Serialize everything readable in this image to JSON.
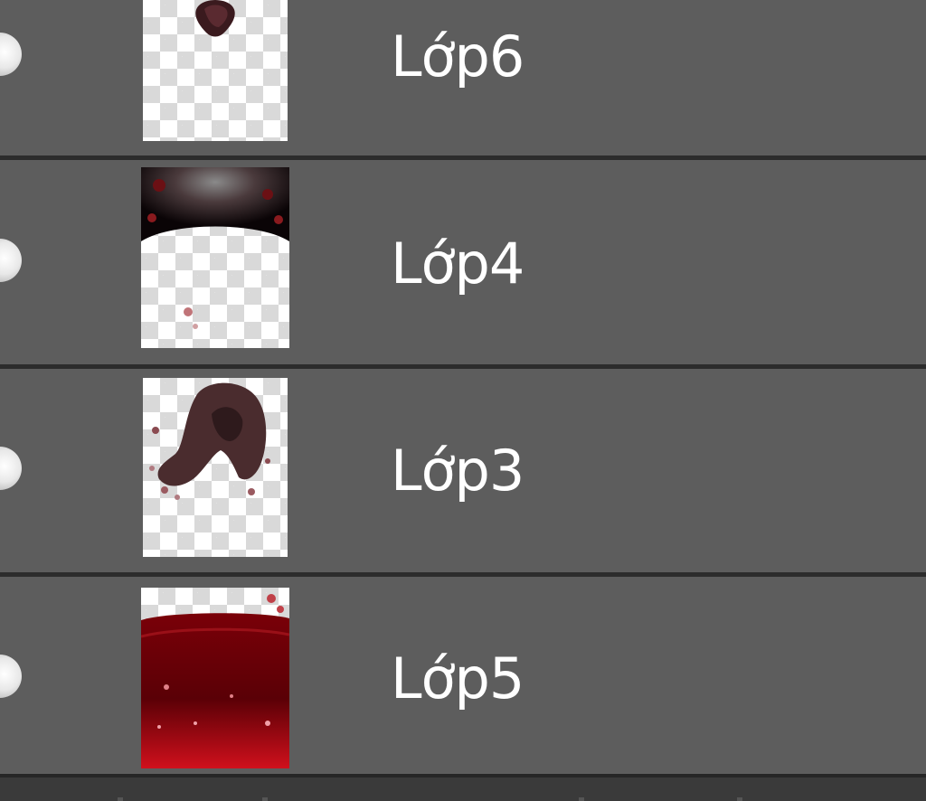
{
  "layers": [
    {
      "name": "Lớp6",
      "thumbnail_icon": "layer-thumbnail-dark-drop"
    },
    {
      "name": "Lớp4",
      "thumbnail_icon": "layer-thumbnail-dark-top-glow"
    },
    {
      "name": "Lớp3",
      "thumbnail_icon": "layer-thumbnail-hair-silhouette"
    },
    {
      "name": "Lớp5",
      "thumbnail_icon": "layer-thumbnail-red-gradient"
    }
  ],
  "colors": {
    "panel_background": "#5d5d5d",
    "separator": "#2c2c2c",
    "label_text": "#ffffff",
    "thumbnail_red": "#b30010"
  }
}
